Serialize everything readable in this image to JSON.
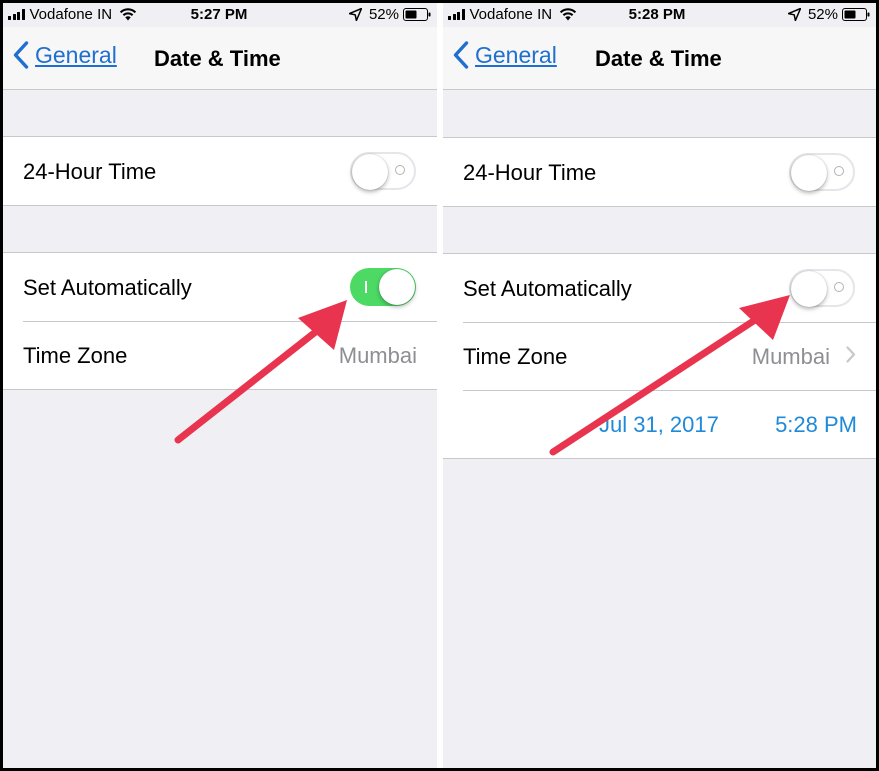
{
  "left": {
    "status": {
      "carrier": "Vodafone IN",
      "time": "5:27 PM",
      "battery": "52%"
    },
    "nav": {
      "back_label": "General",
      "title": "Date & Time"
    },
    "rows": {
      "hour24_label": "24-Hour Time",
      "hour24_on": false,
      "set_auto_label": "Set Automatically",
      "set_auto_on": true,
      "timezone_label": "Time Zone",
      "timezone_value": "Mumbai"
    }
  },
  "right": {
    "status": {
      "carrier": "Vodafone IN",
      "time": "5:28 PM",
      "battery": "52%"
    },
    "nav": {
      "back_label": "General",
      "title": "Date & Time"
    },
    "rows": {
      "hour24_label": "24-Hour Time",
      "hour24_on": false,
      "set_auto_label": "Set Automatically",
      "set_auto_on": false,
      "timezone_label": "Time Zone",
      "timezone_value": "Mumbai",
      "date_value": "Jul 31, 2017",
      "time_value": "5:28 PM"
    }
  },
  "colors": {
    "ios_blue": "#1f6fd1",
    "toggle_green": "#4cd964",
    "arrow_red": "#e8344e",
    "date_blue": "#1f8ad8"
  }
}
